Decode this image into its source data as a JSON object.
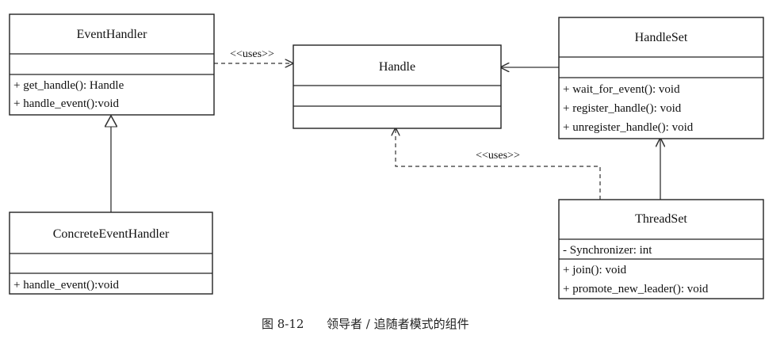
{
  "classes": {
    "event_handler": {
      "name": "EventHandler",
      "attributes": [],
      "methods": [
        "+ get_handle(): Handle",
        "+ handle_event():void"
      ]
    },
    "handle": {
      "name": "Handle",
      "attributes": [],
      "methods": []
    },
    "handle_set": {
      "name": "HandleSet",
      "attributes": [],
      "methods": [
        "+ wait_for_event(): void",
        "+ register_handle(): void",
        "+ unregister_handle(): void"
      ]
    },
    "concrete_event_handler": {
      "name": "ConcreteEventHandler",
      "attributes": [],
      "methods": [
        "+ handle_event():void"
      ]
    },
    "thread_set": {
      "name": "ThreadSet",
      "attributes": [
        "- Synchronizer: int"
      ],
      "methods": [
        "+ join(): void",
        "+ promote_new_leader(): void"
      ]
    }
  },
  "relations": {
    "uses_eventhandler_handle": "<<uses>>",
    "uses_threadset_handle": "<<uses>>"
  },
  "caption": {
    "number": "图 8-12",
    "text": "领导者 / 追随者模式的组件"
  }
}
